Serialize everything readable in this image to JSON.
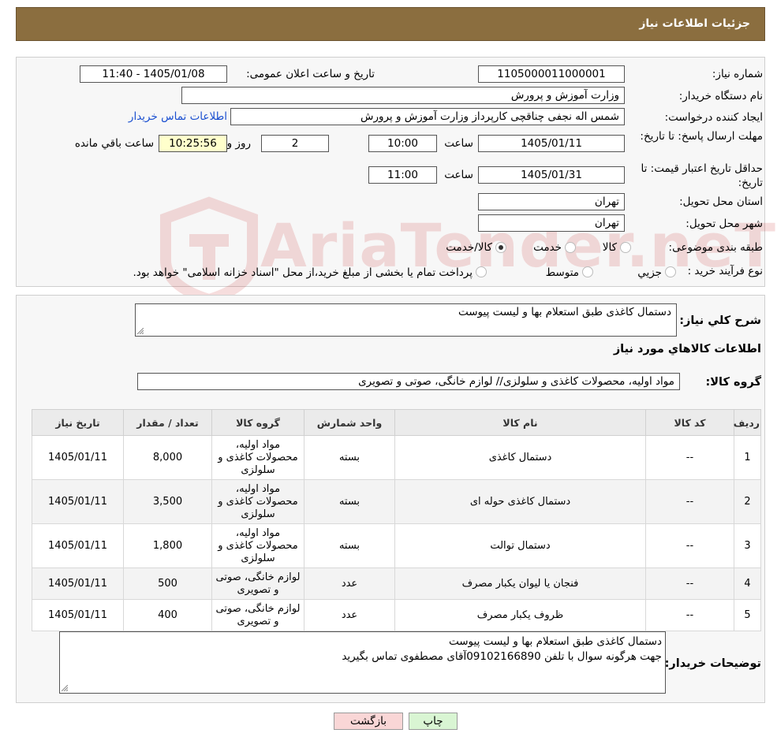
{
  "header": {
    "title": "جزئیات اطلاعات نیاز"
  },
  "form": {
    "need_number_label": "شماره نیاز:",
    "need_number": "1105000011000001",
    "announce_label": "تاریخ و ساعت اعلان عمومی:",
    "announce_value": "1405/01/08 - 11:40",
    "buyer_org_label": "نام دستگاه خریدار:",
    "buyer_org": "وزارت آموزش و پرورش",
    "creator_label": "ایجاد کننده درخواست:",
    "creator": "شمس اله نجفی چناقچی کارپرداز وزارت آموزش و پرورش",
    "contact_link": "اطلاعات تماس خریدار",
    "deadline_label": "مهلت ارسال پاسخ: تا تاریخ:",
    "deadline_date": "1405/01/11",
    "time_label": "ساعت",
    "deadline_time": "10:00",
    "days_value": "2",
    "days_label": "روز و",
    "remaining_time": "10:25:56",
    "remaining_label": "ساعت باقي مانده",
    "price_validity_label": "حداقل تاریخ اعتبار قیمت: تا تاریخ:",
    "price_validity_date": "1405/01/31",
    "price_validity_time": "11:00",
    "province_label": "استان محل تحویل:",
    "province": "تهران",
    "city_label": "شهر محل تحویل:",
    "city": "تهران",
    "category_label": "طبقه بندی موضوعی:",
    "category_options": [
      "کالا",
      "خدمت",
      "کالا/خدمت"
    ],
    "process_label": "نوع فرآیند خرید :",
    "process_options": [
      "جزیي",
      "متوسط"
    ],
    "process_note": "پرداخت تمام یا بخشی از مبلغ خرید،از محل \"اسناد خزانه اسلامی\" خواهد بود."
  },
  "description": {
    "label": "شرح کلي نياز:",
    "value": "دستمال کاغذی طبق استعلام بها و لیست پیوست"
  },
  "goods_section": {
    "title": "اطلاعات کالاهاي مورد نياز",
    "group_label": "گروه کالا:",
    "group_value": "مواد اولیه، محصولات کاغذی و سلولزی// لوازم خانگی، صوتی و تصویری"
  },
  "table": {
    "headers": [
      "ردیف",
      "کد کالا",
      "نام کالا",
      "واحد شمارش",
      "گروه کالا",
      "تعداد / مقدار",
      "تاریخ نیاز"
    ],
    "rows": [
      {
        "row": "1",
        "code": "--",
        "name": "دستمال کاغذی",
        "unit": "بسته",
        "group": "مواد اولیه، محصولات کاغذی و سلولزی",
        "qty": "8,000",
        "date": "1405/01/11"
      },
      {
        "row": "2",
        "code": "--",
        "name": "دستمال کاغذی حوله ای",
        "unit": "بسته",
        "group": "مواد اولیه، محصولات کاغذی و سلولزی",
        "qty": "3,500",
        "date": "1405/01/11"
      },
      {
        "row": "3",
        "code": "--",
        "name": "دستمال توالت",
        "unit": "بسته",
        "group": "مواد اولیه، محصولات کاغذی و سلولزی",
        "qty": "1,800",
        "date": "1405/01/11"
      },
      {
        "row": "4",
        "code": "--",
        "name": "فنجان یا لیوان یکبار مصرف",
        "unit": "عدد",
        "group": "لوازم خانگی، صوتی و تصویری",
        "qty": "500",
        "date": "1405/01/11"
      },
      {
        "row": "5",
        "code": "--",
        "name": "ظروف یکبار مصرف",
        "unit": "عدد",
        "group": "لوازم خانگی، صوتی و تصویری",
        "qty": "400",
        "date": "1405/01/11"
      }
    ]
  },
  "buyer_notes": {
    "label": "توضیحات خریدار:",
    "line1": "دستمال کاغذی طبق استعلام بها و لیست پیوست",
    "line2": "جهت هرگونه سوال با تلفن 09102166890آقای مصطفوی تماس بگیرید"
  },
  "buttons": {
    "print": "چاپ",
    "back": "بازگشت"
  },
  "watermark": {
    "text": "AriaTender.neT"
  },
  "colors": {
    "header": "#8b6e3f",
    "link": "#1a4fd0",
    "print_button": "#d9f5d3",
    "back_button": "#f9d6d6",
    "remaining_field": "#ffffcc"
  }
}
